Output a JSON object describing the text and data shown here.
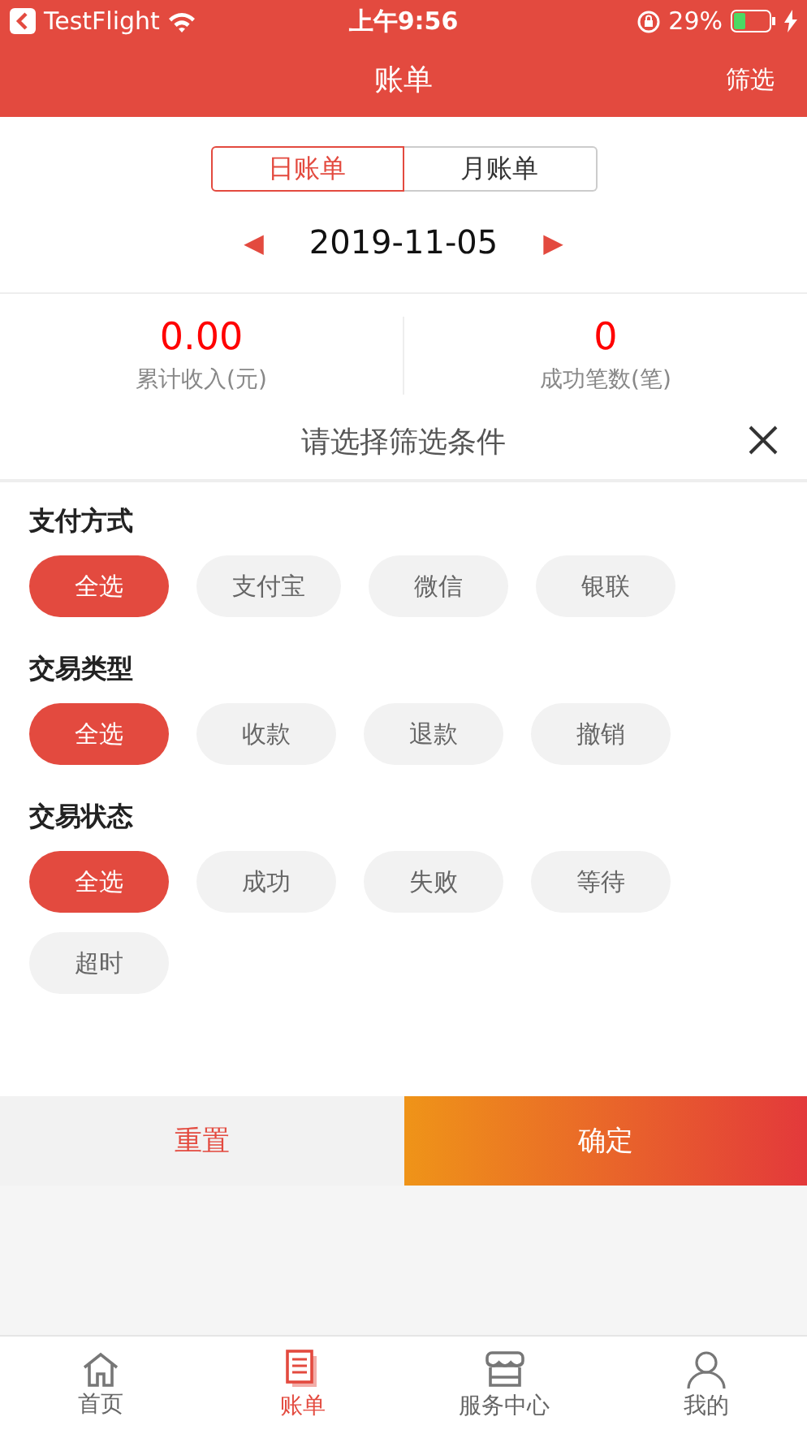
{
  "status_bar": {
    "back_app": "TestFlight",
    "time": "上午9:56",
    "battery": "29%"
  },
  "nav": {
    "title": "账单",
    "action": "筛选"
  },
  "segments": [
    {
      "label": "日账单",
      "selected": true
    },
    {
      "label": "月账单",
      "selected": false
    }
  ],
  "date": {
    "prev": "◀",
    "value": "2019-11-05",
    "next": "▶"
  },
  "stats": [
    {
      "value": "0.00",
      "label": "累计收入(元)"
    },
    {
      "value": "0",
      "label": "成功笔数(笔)"
    }
  ],
  "filter": {
    "title": "请选择筛选条件",
    "sections": [
      {
        "title": "支付方式",
        "options": [
          {
            "label": "全选",
            "selected": true
          },
          {
            "label": "支付宝",
            "selected": false
          },
          {
            "label": "微信",
            "selected": false
          },
          {
            "label": "银联",
            "selected": false
          }
        ]
      },
      {
        "title": "交易类型",
        "options": [
          {
            "label": "全选",
            "selected": true
          },
          {
            "label": "收款",
            "selected": false
          },
          {
            "label": "退款",
            "selected": false
          },
          {
            "label": "撤销",
            "selected": false
          }
        ]
      },
      {
        "title": "交易状态",
        "options": [
          {
            "label": "全选",
            "selected": true
          },
          {
            "label": "成功",
            "selected": false
          },
          {
            "label": "失败",
            "selected": false
          },
          {
            "label": "等待",
            "selected": false
          },
          {
            "label": "超时",
            "selected": false
          }
        ]
      }
    ],
    "reset": "重置",
    "confirm": "确定"
  },
  "tab_bar": [
    {
      "kind": "home",
      "label": "首页",
      "selected": false
    },
    {
      "kind": "bill",
      "label": "账单",
      "selected": true
    },
    {
      "kind": "store",
      "label": "服务中心",
      "selected": false
    },
    {
      "kind": "user",
      "label": "我的",
      "selected": false
    }
  ]
}
